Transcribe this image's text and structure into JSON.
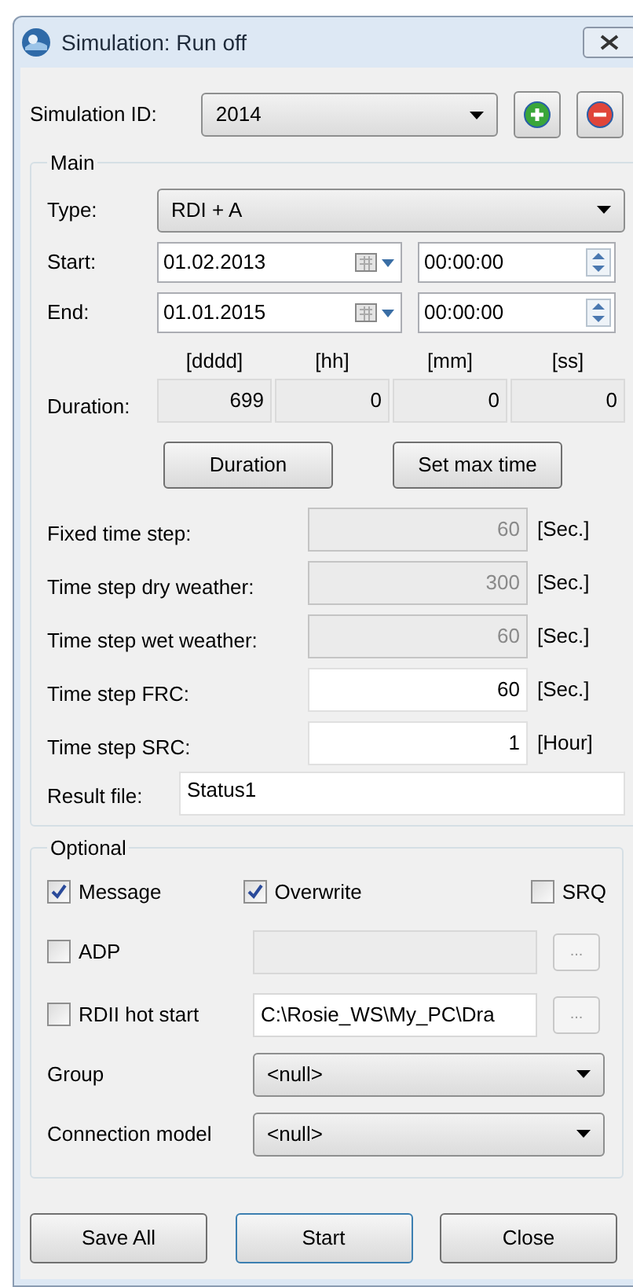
{
  "window": {
    "title": "Simulation: Run off"
  },
  "simulation_id": {
    "label": "Simulation ID:",
    "value": "2014"
  },
  "main": {
    "title": "Main",
    "type": {
      "label": "Type:",
      "value": "RDI + A"
    },
    "dates": [
      {
        "label": "Start:",
        "date": "01.02.2013",
        "time": "00:00:00"
      },
      {
        "label": "End:",
        "date": "01.01.2015",
        "time": "00:00:00"
      }
    ],
    "duration": {
      "label": "Duration:",
      "columns": [
        {
          "header": "[dddd]",
          "value": "699"
        },
        {
          "header": "[hh]",
          "value": "0"
        },
        {
          "header": "[mm]",
          "value": "0"
        },
        {
          "header": "[ss]",
          "value": "0"
        }
      ]
    },
    "buttons": [
      "Duration",
      "Set max time"
    ],
    "time_steps": [
      {
        "label": "Fixed time step:",
        "value": "60",
        "unit": "[Sec.]",
        "disabled": true
      },
      {
        "label": "Time step dry weather:",
        "value": "300",
        "unit": "[Sec.]",
        "disabled": true
      },
      {
        "label": "Time step wet weather:",
        "value": "60",
        "unit": "[Sec.]",
        "disabled": true
      },
      {
        "label": "Time step FRC:",
        "value": "60",
        "unit": "[Sec.]",
        "disabled": false
      },
      {
        "label": "Time step SRC:",
        "value": "1",
        "unit": "[Hour]",
        "disabled": false
      }
    ],
    "result_file": {
      "label": "Result file:",
      "value": "Status1"
    }
  },
  "optional": {
    "title": "Optional",
    "checkboxes": [
      {
        "label": "Message",
        "checked": true
      },
      {
        "label": "Overwrite",
        "checked": true
      },
      {
        "label": "SRQ",
        "checked": false
      }
    ],
    "paths": [
      {
        "label": "ADP",
        "checked": false,
        "browse": "..."
      },
      {
        "label": "RDII hot start",
        "checked": false,
        "value": "C:\\Rosie_WS\\My_PC\\Dra",
        "browse": "..."
      }
    ],
    "selects": [
      {
        "label": "Group",
        "value": "<null>"
      },
      {
        "label": "Connection model",
        "value": "<null>"
      }
    ]
  },
  "buttons": [
    {
      "label": "Save All",
      "selected": false
    },
    {
      "label": "Start",
      "selected": true
    },
    {
      "label": "Close",
      "selected": false
    }
  ]
}
